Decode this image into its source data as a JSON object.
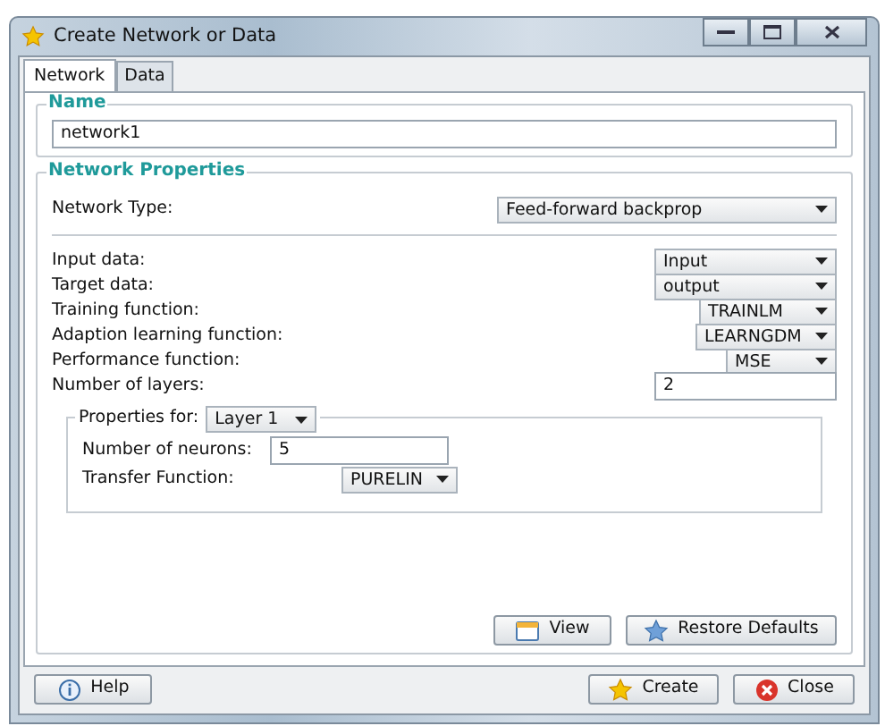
{
  "window": {
    "title": "Create Network or Data"
  },
  "tabs": [
    {
      "label": "Network",
      "selected": true
    },
    {
      "label": "Data",
      "selected": false
    }
  ],
  "name_group": {
    "title": "Name",
    "value": "network1"
  },
  "properties": {
    "title": "Network Properties",
    "network_type": {
      "label": "Network Type:",
      "value": "Feed-forward backprop"
    },
    "rows": [
      {
        "kind": "dropdown",
        "label": "Input data:",
        "value": "Input"
      },
      {
        "kind": "dropdown",
        "label": "Target data:",
        "value": "output"
      },
      {
        "kind": "dropdown",
        "label": "Training function:",
        "value": "TRAINLM"
      },
      {
        "kind": "dropdown",
        "label": "Adaption learning function:",
        "value": "LEARNGDM"
      },
      {
        "kind": "dropdown",
        "label": "Performance function:",
        "value": "MSE"
      },
      {
        "kind": "field",
        "label": "Number of layers:",
        "value": "2"
      }
    ],
    "layer_group": {
      "label": "Properties for:",
      "layer": "Layer 1",
      "rows": [
        {
          "kind": "field",
          "label": "Number of neurons:",
          "value": "5"
        },
        {
          "kind": "dropdown",
          "label": "Transfer Function:",
          "value": "PURELIN"
        }
      ]
    },
    "buttons": [
      {
        "kind": "view",
        "label": "View"
      },
      {
        "kind": "restore",
        "label": "Restore Defaults"
      }
    ]
  },
  "footer_buttons": [
    {
      "kind": "help",
      "label": "Help"
    },
    {
      "kind": "create",
      "label": "Create"
    },
    {
      "kind": "close",
      "label": "Close"
    }
  ]
}
